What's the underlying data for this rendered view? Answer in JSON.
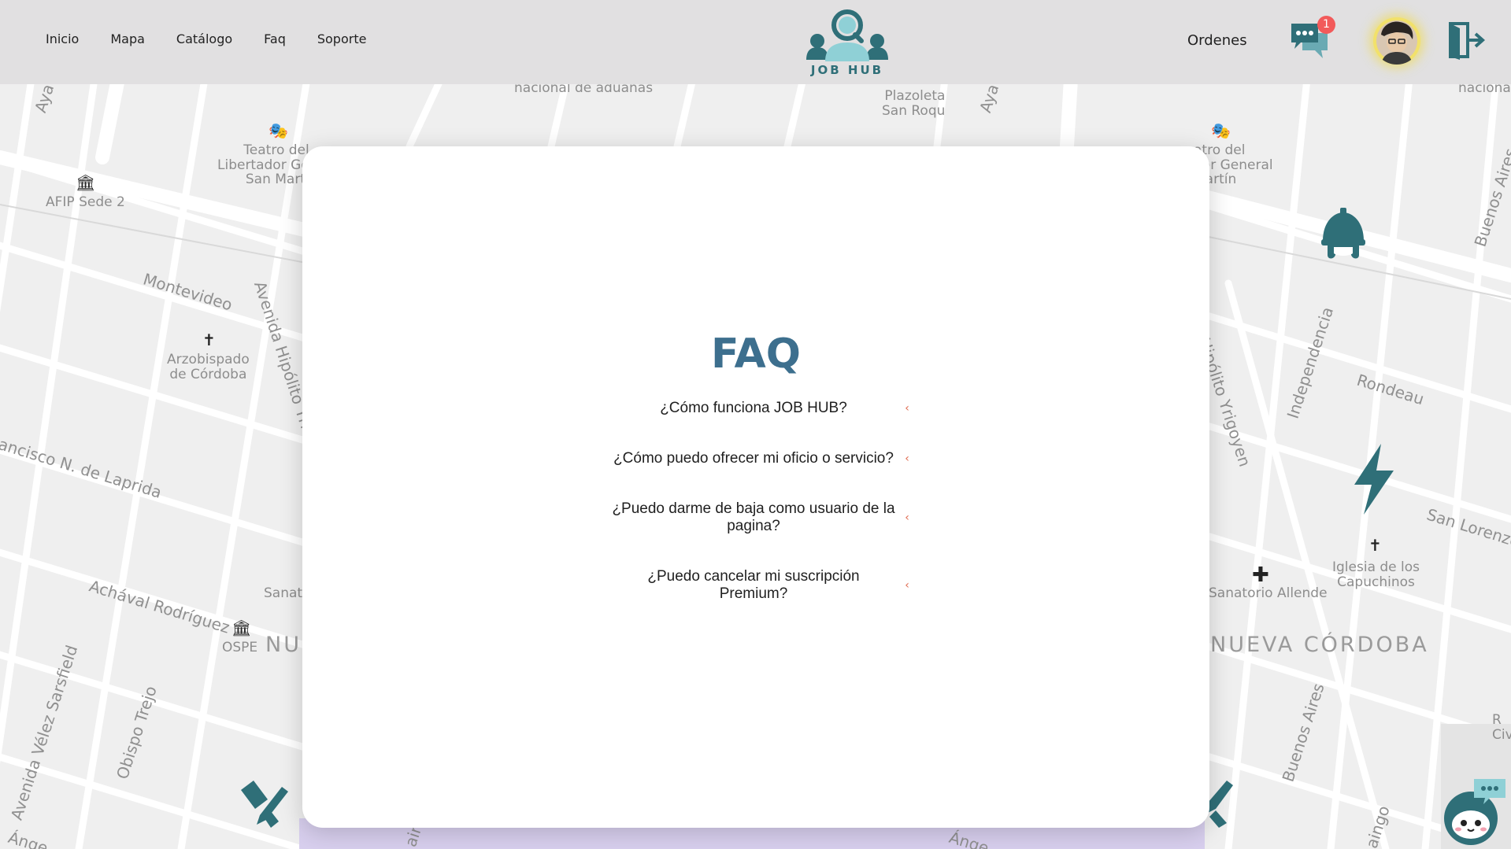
{
  "nav": {
    "items": [
      "Inicio",
      "Mapa",
      "Catálogo",
      "Faq",
      "Soporte"
    ]
  },
  "brand": {
    "logo_text": "JOB HUB"
  },
  "header_right": {
    "orders_label": "Ordenes",
    "chat_badge_count": "1"
  },
  "faq": {
    "title": "FAQ",
    "questions": [
      "¿Cómo funciona JOB HUB?",
      "¿Cómo puedo ofrecer mi oficio o servicio?",
      "¿Puedo darme de baja como usuario de la pagina?",
      "¿Puedo cancelar mi suscripción Premium?"
    ],
    "chevron": "‹"
  },
  "map": {
    "labels": {
      "aduanas": "nacional de aduanas",
      "nacional": "nacional",
      "plazoleta": "Plazoleta\nSan Roqu",
      "teatro_left": "Teatro del\nLibertador Ge\nSan Marti",
      "teatro_right": "atro del\ndor General\nMartín",
      "afip": "AFIP Sede 2",
      "montevideo": "Montevideo",
      "hipolito_left": "Avenida Hipólito Yri",
      "hipolito_right": "Hipólito Yrigoyen",
      "arzobispado": "Arzobispado\nde Córdoba",
      "laprida": "ancisco N. de Laprida",
      "achaval": "Achával Rodríguez",
      "sanat_left": "Sanat",
      "ospe": "OSPE",
      "nu": "NU",
      "velez": "Avenida Vélez Sarsfield",
      "trejo": "Obispo Trejo",
      "independencia": "Independencia",
      "rondeau": "Rondeau",
      "san_lorenzo": "San Lorenzo",
      "buenos_aires_top": "Buenos Aires",
      "buenos_aires_bottom": "Buenos Aires",
      "iglesia": "Iglesia de los\nCapuchinos",
      "sanatorio": "Sanatorio Allende",
      "nueva_cordoba": "NUEVA CÓRDOBA",
      "aya_left": "Aya",
      "aya_mid": "Aya",
      "angel_left": "Ánge",
      "angel_right": "Ánge",
      "aingo": "aingo",
      "ain": "ain",
      "r_civ": "R\nCiv"
    }
  }
}
